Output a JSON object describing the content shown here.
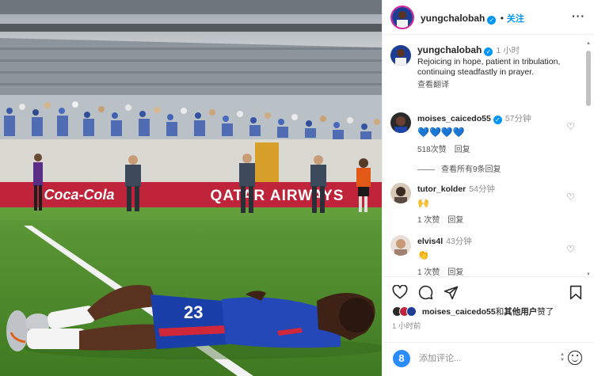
{
  "post": {
    "author": "yungchalobah",
    "follow_label": "关注",
    "more_label": "···",
    "caption": {
      "username": "yungchalobah",
      "time": "1 小时",
      "text": "Rejoicing in hope, patient in tribulation, continuing steadfastly in prayer.",
      "translate_label": "查看翻译"
    },
    "photo": {
      "sponsor_left": "Coca-Cola",
      "sponsor_right": "QATAR AIRWAYS",
      "jersey_number": "23"
    }
  },
  "comments": [
    {
      "username": "moises_caicedo55",
      "verified": true,
      "time": "57分钟",
      "text": "💙💙💙💙",
      "likes": "518次赞",
      "reply": "回复"
    },
    {
      "username": "tutor_kolder",
      "verified": false,
      "time": "54分钟",
      "text": "🙌",
      "likes": "1 次赞",
      "reply": "回复"
    },
    {
      "username": "elvis4l",
      "verified": false,
      "time": "43分钟",
      "text": "👏",
      "likes": "1 次赞",
      "reply": "回复"
    }
  ],
  "view_replies_label": "查看所有9条回复",
  "likes": {
    "user": "moises_caicedo55",
    "connector": "和",
    "others": "其他用户",
    "suffix": "赞了"
  },
  "post_time": "1 小时前",
  "add_comment": {
    "placeholder": "添加评论..."
  },
  "icons": {
    "like": "heart-icon",
    "comment": "comment-icon",
    "share": "send-icon",
    "save": "bookmark-icon",
    "emoji": "emoji-icon",
    "app": "app-logo-icon"
  },
  "colors": {
    "accent": "#0095f6",
    "verified": "#0095f6",
    "heart": "#262626",
    "jersey": "#1a3fa8"
  }
}
